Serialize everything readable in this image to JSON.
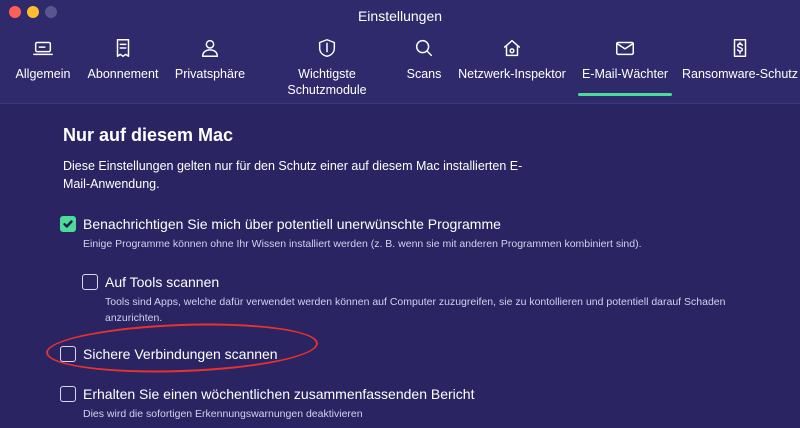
{
  "window": {
    "title": "Einstellungen",
    "traffic_lights": [
      "#ff5f57",
      "#febc2e",
      "#5a5590"
    ]
  },
  "tabs": [
    {
      "label": "Allgemein",
      "icon": "laptop-icon"
    },
    {
      "label": "Abonnement",
      "icon": "receipt-icon"
    },
    {
      "label": "Privatsphäre",
      "icon": "person-icon"
    },
    {
      "label": "Wichtigste\nSchutzmodule",
      "icon": "shield-icon"
    },
    {
      "label": "Scans",
      "icon": "search-icon"
    },
    {
      "label": "Netzwerk-Inspektor",
      "icon": "home-network-icon"
    },
    {
      "label": "E-Mail-Wächter",
      "icon": "mail-icon",
      "active": true
    },
    {
      "label": "Ransomware-Schutz",
      "icon": "dollar-file-icon"
    }
  ],
  "section": {
    "title": "Nur auf diesem Mac",
    "description": "Diese Einstellungen gelten nur für den Schutz einer auf diesem Mac installierten E-Mail-Anwendung."
  },
  "options": [
    {
      "label": "Benachrichtigen Sie mich über potentiell unerwünschte Programme",
      "help": "Einige Programme können ohne Ihr Wissen installiert werden (z. B. wenn sie mit anderen Programmen kombiniert sind).",
      "checked": true
    },
    {
      "label": "Auf Tools scannen",
      "help": "Tools sind Apps, welche dafür verwendet werden können auf Computer zuzugreifen, sie zu kontollieren und potentiell darauf Schaden anzurichten.",
      "checked": false
    },
    {
      "label": "Sichere Verbindungen scannen",
      "help": "",
      "checked": false
    },
    {
      "label": "Erhalten Sie einen wöchentlichen zusammenfassenden Bericht",
      "help": "Dies wird die sofortigen Erkennungswarnungen deaktivieren",
      "checked": false
    }
  ],
  "colors": {
    "background": "#2a2463",
    "toolbar": "#2f2a6c",
    "accent_green": "#4ddb9a",
    "annotation_red": "#e8322e"
  }
}
